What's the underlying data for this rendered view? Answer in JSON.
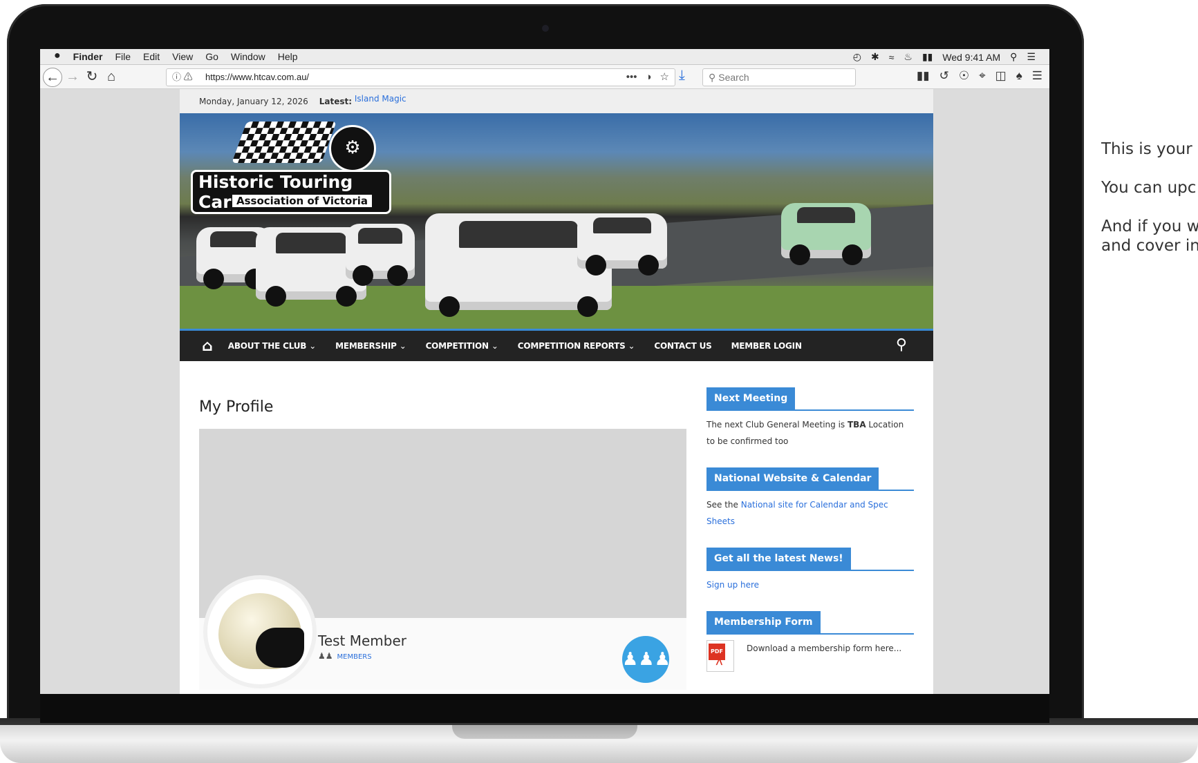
{
  "side_text": {
    "line1": "This is your",
    "line2": "You can upc",
    "line3a": "And if you w",
    "line3b": "and cover in"
  },
  "menubar": {
    "apple": "",
    "items": [
      "Finder",
      "File",
      "Edit",
      "View",
      "Go",
      "Window",
      "Help"
    ],
    "clock": "Wed 9:41 AM"
  },
  "browser": {
    "url": "https://www.htcav.com.au/",
    "url_more": "•••",
    "search_placeholder": "Search"
  },
  "site": {
    "date": "Monday, January 12, 2026",
    "latest_label": "Latest:",
    "latest_link": "Island Magic",
    "logo_title": "Historic Touring Car",
    "logo_subtitle": "Association of Victoria",
    "nav": {
      "items": [
        {
          "label": "ABOUT THE CLUB",
          "chevron": true
        },
        {
          "label": "MEMBERSHIP",
          "chevron": true
        },
        {
          "label": "COMPETITION",
          "chevron": true
        },
        {
          "label": "COMPETITION REPORTS",
          "chevron": true
        },
        {
          "label": "CONTACT US",
          "chevron": false
        },
        {
          "label": "MEMBER LOGIN",
          "chevron": false
        }
      ]
    },
    "page_title": "My Profile",
    "profile": {
      "name": "Test Member",
      "role": "MEMBERS"
    },
    "sidebar": {
      "next_meeting": {
        "title": "Next Meeting",
        "text_pre": "The next Club General Meeting is ",
        "text_bold": "TBA",
        "text_post": " Location to be confirmed too"
      },
      "national": {
        "title": "National Website & Calendar",
        "text_pre": "See the ",
        "link": "National site for Calendar and Spec Sheets"
      },
      "news": {
        "title": "Get all the latest News!",
        "link": "Sign up here"
      },
      "membership_form": {
        "title": "Membership Form",
        "text": "Download a membership form here...",
        "pdf_tag": "PDF"
      }
    }
  },
  "colors": {
    "accent": "#3a8ad6",
    "nav_bg": "#232323",
    "link": "#2a6fdb",
    "members_button": "#3aa3e3"
  }
}
